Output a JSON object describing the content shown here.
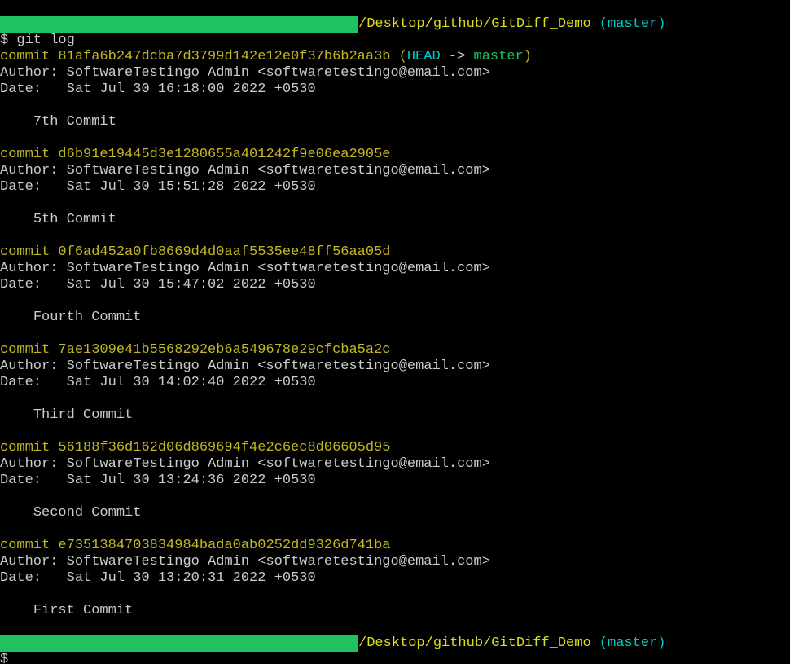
{
  "prompt1": {
    "path": "/Desktop/github/GitDiff_Demo",
    "branch": "(master)",
    "symbol": "$",
    "command": "git log"
  },
  "prompt2": {
    "path": "/Desktop/github/GitDiff_Demo",
    "branch": "(master)",
    "symbol": "$"
  },
  "commits": [
    {
      "commitLabel": "commit",
      "hash": "81afa6b247dcba7d3799d142e12e0f37b6b2aa3b",
      "head": "HEAD",
      "arrow": " -> ",
      "branch": "master",
      "authorLabel": "Author:",
      "author": "SoftwareTestingo Admin <softwaretestingo@email.com>",
      "dateLabel": "Date:",
      "date": "Sat Jul 30 16:18:00 2022 +0530",
      "message": "7th Commit"
    },
    {
      "commitLabel": "commit",
      "hash": "d6b91e19445d3e1280655a401242f9e06ea2905e",
      "authorLabel": "Author:",
      "author": "SoftwareTestingo Admin <softwaretestingo@email.com>",
      "dateLabel": "Date:",
      "date": "Sat Jul 30 15:51:28 2022 +0530",
      "message": "5th Commit"
    },
    {
      "commitLabel": "commit",
      "hash": "0f6ad452a0fb8669d4d0aaf5535ee48ff56aa05d",
      "authorLabel": "Author:",
      "author": "SoftwareTestingo Admin <softwaretestingo@email.com>",
      "dateLabel": "Date:",
      "date": "Sat Jul 30 15:47:02 2022 +0530",
      "message": "Fourth Commit"
    },
    {
      "commitLabel": "commit",
      "hash": "7ae1309e41b5568292eb6a549678e29cfcba5a2c",
      "authorLabel": "Author:",
      "author": "SoftwareTestingo Admin <softwaretestingo@email.com>",
      "dateLabel": "Date:",
      "date": "Sat Jul 30 14:02:40 2022 +0530",
      "message": "Third Commit"
    },
    {
      "commitLabel": "commit",
      "hash": "56188f36d162d06d869694f4e2c6ec8d06605d95",
      "authorLabel": "Author:",
      "author": "SoftwareTestingo Admin <softwaretestingo@email.com>",
      "dateLabel": "Date:",
      "date": "Sat Jul 30 13:24:36 2022 +0530",
      "message": "Second Commit"
    },
    {
      "commitLabel": "commit",
      "hash": "e7351384703834984bada0ab0252dd9326d741ba",
      "authorLabel": "Author:",
      "author": "SoftwareTestingo Admin <softwaretestingo@email.com>",
      "dateLabel": "Date:",
      "date": "Sat Jul 30 13:20:31 2022 +0530",
      "message": "First Commit"
    }
  ]
}
